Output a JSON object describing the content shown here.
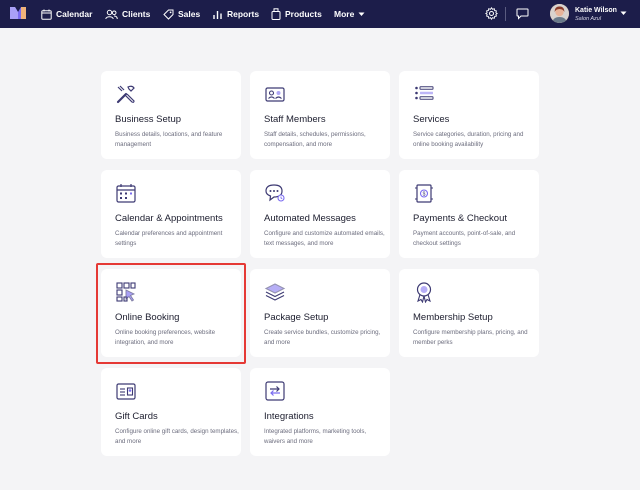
{
  "nav": {
    "items": [
      {
        "label": "Calendar",
        "icon": "calendar-icon"
      },
      {
        "label": "Clients",
        "icon": "clients-icon"
      },
      {
        "label": "Sales",
        "icon": "tag-icon"
      },
      {
        "label": "Reports",
        "icon": "reports-icon"
      },
      {
        "label": "Products",
        "icon": "products-icon"
      }
    ],
    "more_label": "More",
    "settings_icon": "gear-icon",
    "messages_icon": "chat-icon"
  },
  "user": {
    "name": "Katie Wilson",
    "business": "Salon Azul"
  },
  "cards": [
    {
      "title": "Business Setup",
      "desc": "Business details, locations, and feature management",
      "icon": "tools-icon"
    },
    {
      "title": "Staff Members",
      "desc": "Staff details, schedules, permissions, compensation, and more",
      "icon": "staff-icon"
    },
    {
      "title": "Services",
      "desc": "Service categories, duration, pricing and online booking availability",
      "icon": "list-icon"
    },
    {
      "title": "Calendar & Appointments",
      "desc": "Calendar preferences and appointment settings",
      "icon": "calendar-icon"
    },
    {
      "title": "Automated Messages",
      "desc": "Configure and customize automated emails, text messages, and more",
      "icon": "messages-icon"
    },
    {
      "title": "Payments & Checkout",
      "desc": "Payment accounts, point-of-sale, and checkout settings",
      "icon": "payment-icon"
    },
    {
      "title": "Online Booking",
      "desc": "Online booking preferences, website integration, and more",
      "icon": "online-booking-icon"
    },
    {
      "title": "Package Setup",
      "desc": "Create service bundles, customize pricing, and more",
      "icon": "layers-icon"
    },
    {
      "title": "Membership Setup",
      "desc": "Configure membership plans, pricing, and member perks",
      "icon": "badge-icon"
    },
    {
      "title": "Gift Cards",
      "desc": "Configure online gift cards, design templates, and more",
      "icon": "gift-card-icon"
    },
    {
      "title": "Integrations",
      "desc": "Integrated platforms, marketing tools, waivers and more",
      "icon": "sync-icon"
    }
  ],
  "colors": {
    "topbar": "#1c1d4a",
    "icon_accent": "#4a3fa0",
    "highlight": "#e53935"
  }
}
